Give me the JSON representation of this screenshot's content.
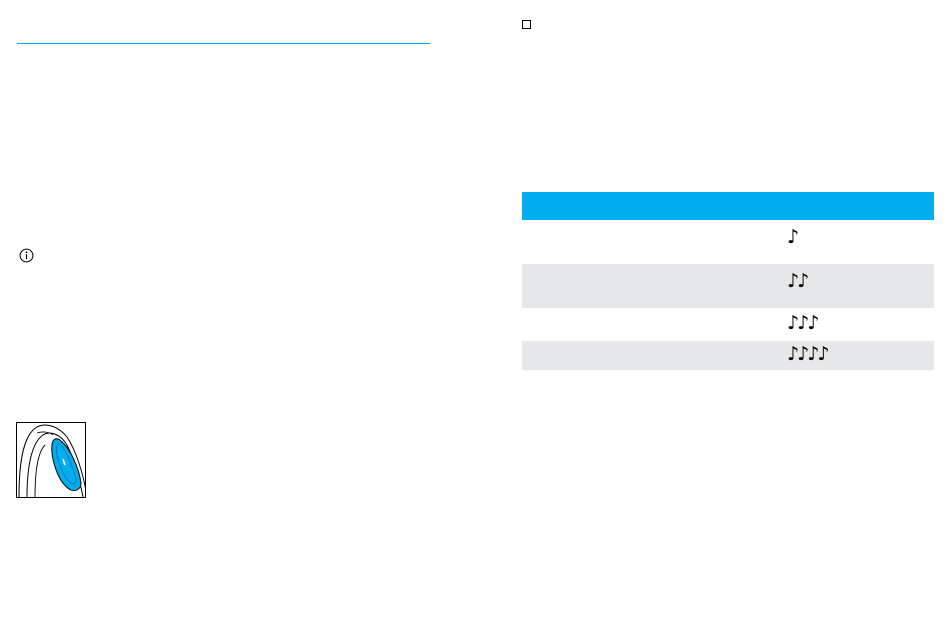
{
  "colors": {
    "accent": "#00aeef",
    "row_shade": "#e6e7e8"
  },
  "icons": {
    "checkbox": "checkbox-square-icon",
    "info": "info-circle-icon",
    "device": "hearing-aid-button-illustration"
  },
  "tones_table": {
    "header": {
      "label": "",
      "tone": ""
    },
    "rows": [
      {
        "label": "",
        "tone": "♪"
      },
      {
        "label": "",
        "tone": "♪♪"
      },
      {
        "label": "",
        "tone": "♪♪♪"
      },
      {
        "label": "",
        "tone": "♪♪♪♪"
      }
    ]
  }
}
